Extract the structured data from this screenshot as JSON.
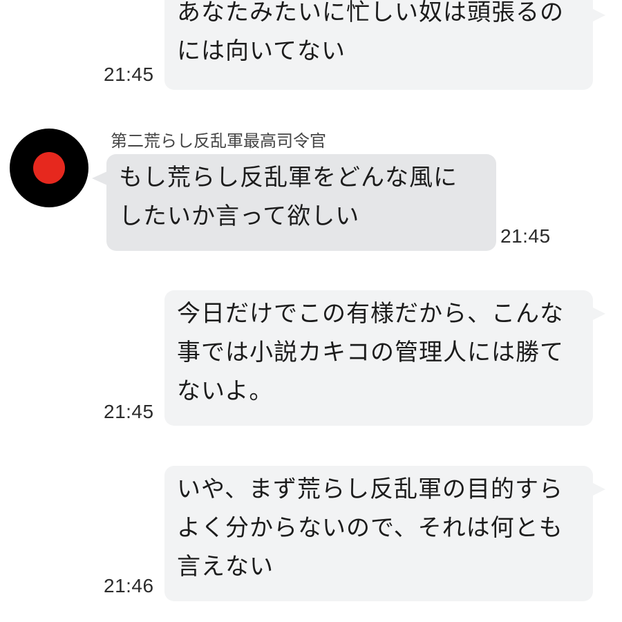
{
  "colors": {
    "outgoing_bubble": "#f2f3f4",
    "incoming_bubble": "#e5e6e8",
    "avatar_bg": "#000000",
    "avatar_dot": "#e6281e"
  },
  "messages": [
    {
      "direction": "outgoing",
      "lines": [
        "あなたみたいに忙しい奴は頭張るの",
        "には向いてない"
      ],
      "time": "21:45"
    },
    {
      "direction": "incoming",
      "sender": "第二荒らし反乱軍最高司令官",
      "avatar": "red-dot-avatar-icon",
      "lines": [
        "もし荒らし反乱軍をどんな風に",
        "したいか言って欲しい"
      ],
      "time": "21:45"
    },
    {
      "direction": "outgoing",
      "lines": [
        "今日だけでこの有様だから、こんな",
        "事では小説カキコの管理人には勝て",
        "ないよ。"
      ],
      "time": "21:45"
    },
    {
      "direction": "outgoing",
      "lines": [
        "いや、まず荒らし反乱軍の目的すら",
        "よく分からないので、それは何とも",
        "言えない"
      ],
      "time": "21:46"
    }
  ]
}
